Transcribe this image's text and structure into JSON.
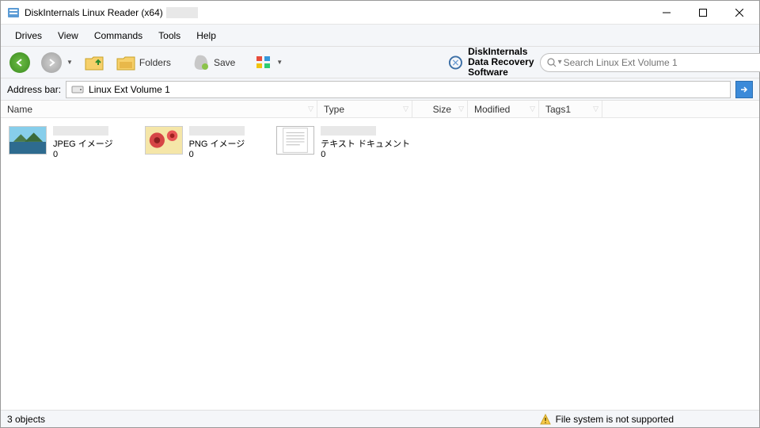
{
  "window": {
    "title": "DiskInternals Linux Reader (x64)"
  },
  "menu": {
    "items": [
      "Drives",
      "View",
      "Commands",
      "Tools",
      "Help"
    ]
  },
  "toolbar": {
    "folders_label": "Folders",
    "save_label": "Save",
    "brand_line1": "DiskInternals",
    "brand_line2": "Data Recovery Software",
    "search_placeholder": "Search Linux Ext Volume 1"
  },
  "addressbar": {
    "label": "Address bar:",
    "path": "Linux Ext Volume 1"
  },
  "columns": {
    "name": "Name",
    "type": "Type",
    "size": "Size",
    "modified": "Modified",
    "tags": "Tags1"
  },
  "files": [
    {
      "type": "JPEG イメージ",
      "count": "0",
      "thumb": "landscape"
    },
    {
      "type": "PNG イメージ",
      "count": "0",
      "thumb": "flower"
    },
    {
      "type": "テキスト ドキュメント",
      "count": "0",
      "thumb": "text"
    }
  ],
  "statusbar": {
    "count": "3 objects",
    "warning": "File system is not supported"
  }
}
